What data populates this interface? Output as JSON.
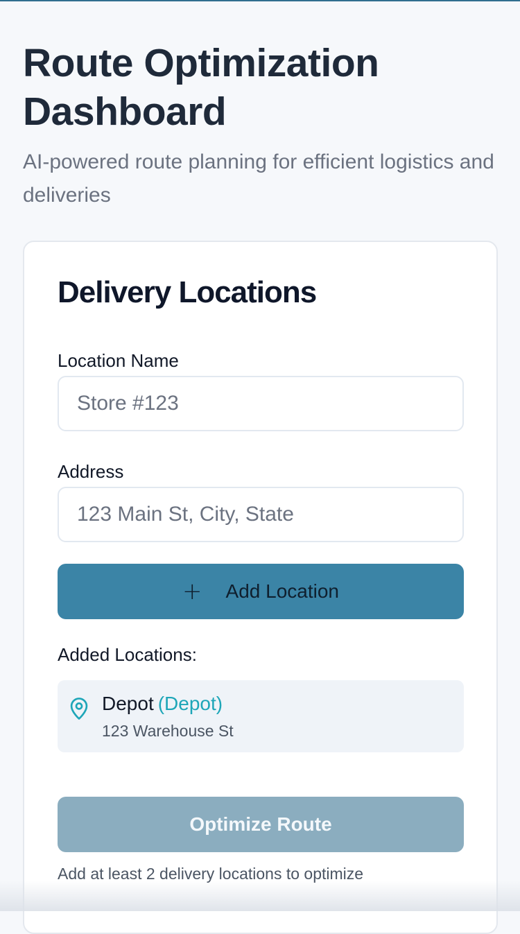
{
  "header": {
    "title": "Route Optimization Dashboard",
    "subtitle": "AI-powered route planning for efficient logistics and deliveries"
  },
  "card": {
    "title": "Delivery Locations",
    "location_name": {
      "label": "Location Name",
      "placeholder": "Store #123",
      "value": ""
    },
    "address": {
      "label": "Address",
      "placeholder": "123 Main St, City, State",
      "value": ""
    },
    "add_button": {
      "icon": "plus-icon",
      "label": "Add Location"
    },
    "added_label": "Added Locations:",
    "locations": [
      {
        "icon": "map-pin-icon",
        "name": "Depot",
        "tag": "(Depot)",
        "address": "123 Warehouse St"
      }
    ],
    "optimize_button": {
      "label": "Optimize Route",
      "disabled": true
    },
    "hint": "Add at least 2 delivery locations to optimize"
  },
  "colors": {
    "accent": "#3b84a6",
    "accent_disabled": "#8badbf",
    "depot_tag": "#1ea6b8",
    "title_text": "#1f2a3a"
  }
}
